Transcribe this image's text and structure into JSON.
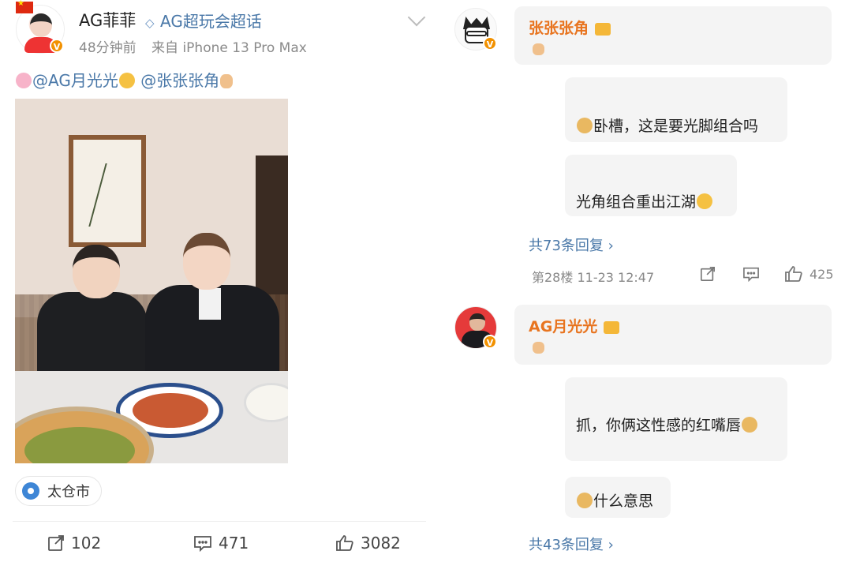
{
  "post": {
    "author": "AG菲菲",
    "topic": "AG超玩会超话",
    "time": "48分钟前",
    "source": "来自 iPhone 13 Pro Max",
    "mention1": "@AG月光光",
    "mention2": "@张张张角",
    "location": "太仓市",
    "reposts": "102",
    "comments": "471",
    "likes": "3082",
    "verified_badge": "V"
  },
  "comments": [
    {
      "user": "张张张角",
      "replies": [
        "卧槽，这是要光脚组合吗",
        "光角组合重出江湖"
      ],
      "more": "共73条回复",
      "floor": "第28楼",
      "date": "11-23 12:47",
      "likes": "425"
    },
    {
      "user": "AG月光光",
      "replies": [
        "抓，你俩这性感的红嘴唇",
        "什么意思"
      ],
      "more": "共43条回复"
    }
  ],
  "icons": {
    "topic": "diamond-icon",
    "location": "pin-icon",
    "repost": "share-icon",
    "comment": "comment-icon",
    "like": "thumbs-up-icon",
    "more": "chevron-down-icon"
  },
  "colors": {
    "link": "#4a78a8",
    "username": "#e8741f",
    "verified": "#f29100"
  }
}
